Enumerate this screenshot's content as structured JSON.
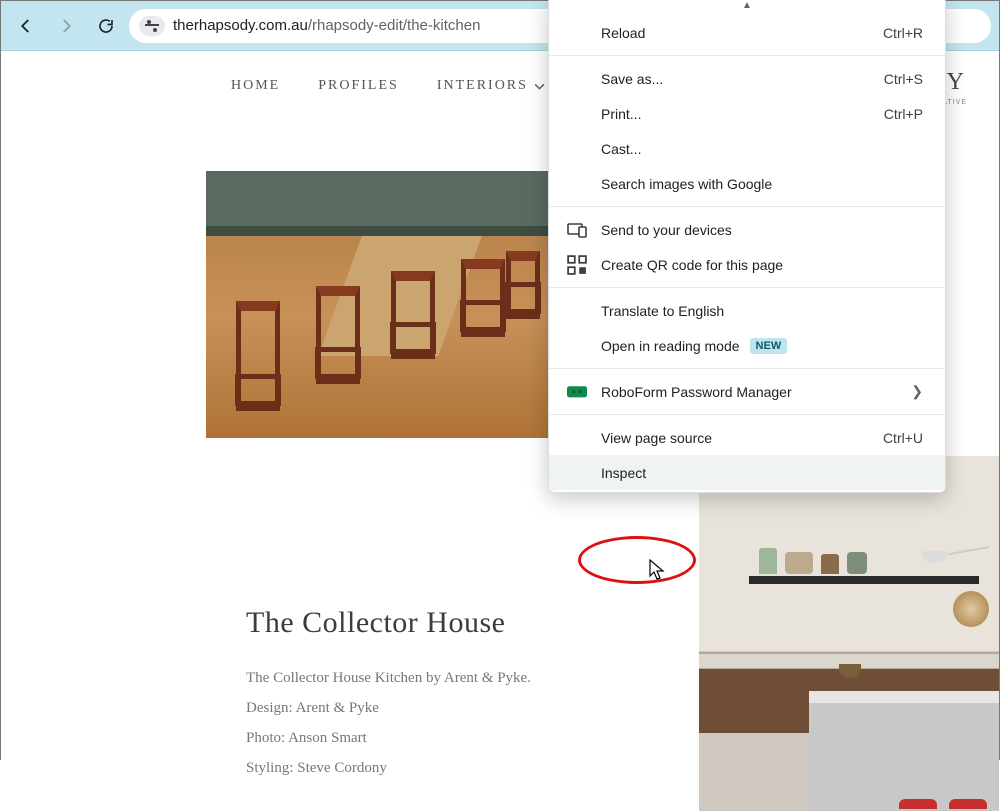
{
  "addr": {
    "host": "therhapsody.com.au",
    "path": "/rhapsody-edit/the-kitchen"
  },
  "nav": {
    "home": "HOME",
    "profiles": "PROFILES",
    "interiors": "INTERIORS"
  },
  "brand": "DY",
  "subbrand": "CREATIVE",
  "article": {
    "title": "The Collector House",
    "l1": "The Collector House Kitchen by Arent & Pyke.",
    "l2": "Design: Arent & Pyke",
    "l3": "Photo: Anson Smart",
    "l4": "Styling: Steve Cordony"
  },
  "ctx": {
    "reload": {
      "label": "Reload",
      "key": "Ctrl+R"
    },
    "saveas": {
      "label": "Save as...",
      "key": "Ctrl+S"
    },
    "print": {
      "label": "Print...",
      "key": "Ctrl+P"
    },
    "cast": {
      "label": "Cast..."
    },
    "search_img": {
      "label": "Search images with Google"
    },
    "send_devices": {
      "label": "Send to your devices"
    },
    "qr": {
      "label": "Create QR code for this page"
    },
    "translate": {
      "label": "Translate to English"
    },
    "reading": {
      "label": "Open in reading mode",
      "badge": "NEW"
    },
    "roboform": {
      "label": "RoboForm Password Manager"
    },
    "source": {
      "label": "View page source",
      "key": "Ctrl+U"
    },
    "inspect": {
      "label": "Inspect"
    }
  }
}
